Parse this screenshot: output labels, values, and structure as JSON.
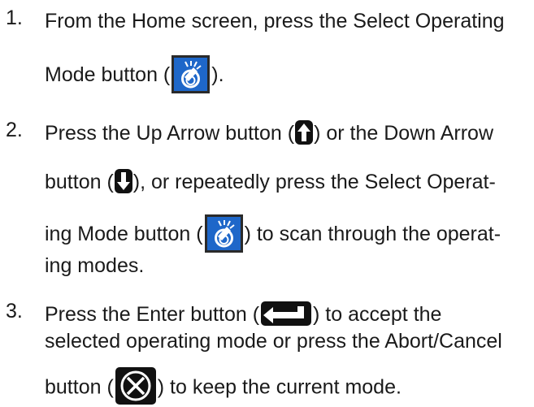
{
  "steps": [
    {
      "number": "1.",
      "line1": "From the Home screen, press the Select Operating",
      "line2_pre": "Mode button (",
      "line2_post": ")."
    },
    {
      "number": "2.",
      "line1_pre": "Press the Up Arrow button (",
      "line1_post": ") or the Down Arrow",
      "line2_pre": "button (",
      "line2_post": "), or repeatedly press the Select Operat-",
      "line3_pre": "ing Mode button (",
      "line3_post": ") to scan through the operat-",
      "line4": "ing modes."
    },
    {
      "number": "3.",
      "line1_pre": "Press the Enter button (",
      "line1_post": ") to accept the",
      "line2": "selected operating mode or press the Abort/Cancel",
      "line3_pre": "button (",
      "line3_post": ") to keep the current mode."
    }
  ],
  "icons": {
    "mode": "select-operating-mode-icon",
    "up": "up-arrow-icon",
    "down": "down-arrow-icon",
    "enter": "enter-icon",
    "abort": "abort-cancel-icon"
  },
  "colors": {
    "text": "#1a1a1a",
    "mode_button_blue": "#1e67c9",
    "button_black": "#111111"
  }
}
